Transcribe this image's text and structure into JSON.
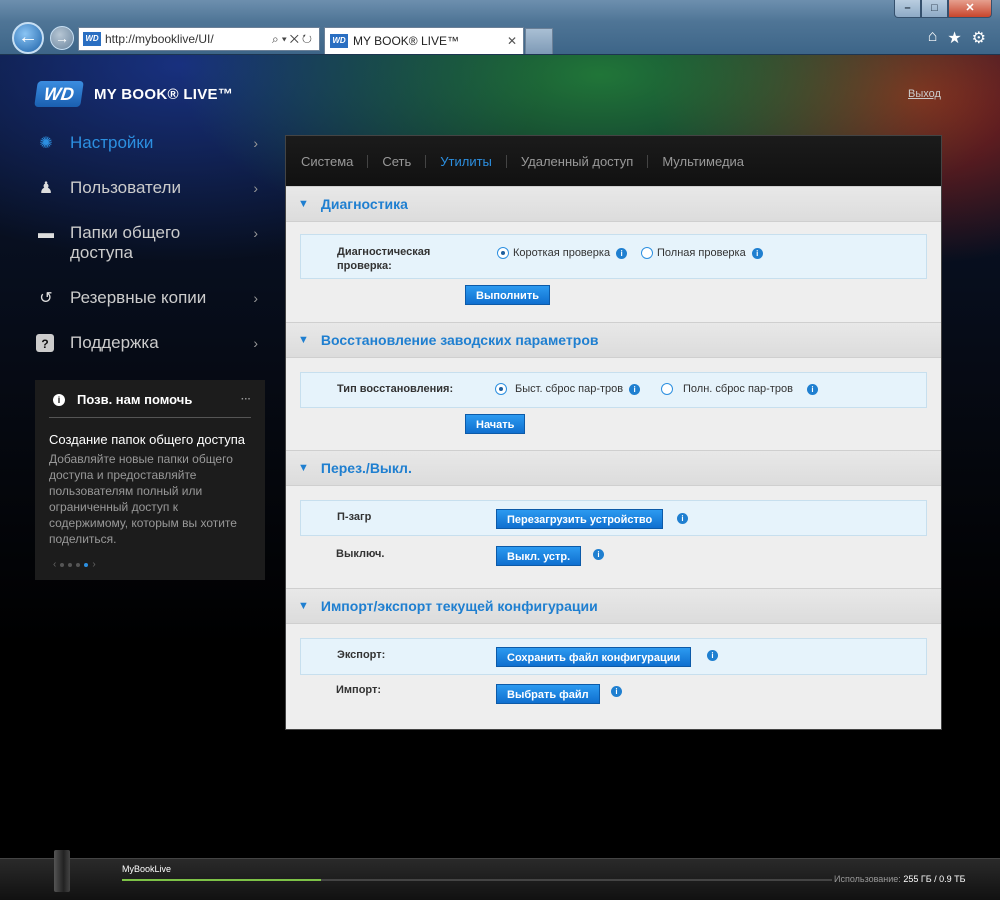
{
  "browser": {
    "url": "http://mybooklive/UI/",
    "tab_title": "MY BOOK® LIVE™",
    "favicon_text": "WD"
  },
  "header": {
    "logo_text": "WD",
    "product": "MY BOOK® LIVE™",
    "logout": "Выход"
  },
  "sidebar": {
    "items": [
      {
        "label": "Настройки",
        "icon": "gear-icon"
      },
      {
        "label": "Пользователи",
        "icon": "users-icon"
      },
      {
        "label": "Папки общего доступа",
        "icon": "folder-icon"
      },
      {
        "label": "Резервные копии",
        "icon": "history-icon"
      },
      {
        "label": "Поддержка",
        "icon": "question-icon"
      }
    ],
    "help": {
      "title": "Позв. нам помочь",
      "article_title": "Создание папок общего доступа",
      "article_body": "Добавляйте новые папки общего доступа и предоставляйте пользователям полный или ограниченный доступ к содержимому, которым вы хотите поделиться."
    }
  },
  "tabs": [
    "Система",
    "Сеть",
    "Утилиты",
    "Удаленный доступ",
    "Мультимедиа"
  ],
  "sections": {
    "diag": {
      "title": "Диагностика",
      "label": "Диагностическая проверка:",
      "opt_short": "Короткая проверка",
      "opt_full": "Полная проверка",
      "button": "Выполнить"
    },
    "restore": {
      "title": "Восстановление заводских параметров",
      "label": "Тип восстановления:",
      "opt_quick": "Быст. сброс пар-тров",
      "opt_full": "Полн. сброс пар-тров",
      "button": "Начать"
    },
    "power": {
      "title": "Перез./Выкл.",
      "reboot_label": "П-загр",
      "reboot_button": "Перезагрузить устройство",
      "off_label": "Выключ.",
      "off_button": "Выкл. устр."
    },
    "config": {
      "title": "Импорт/экспорт текущей конфигурации",
      "export_label": "Экспорт:",
      "export_button": "Сохранить файл конфигурации",
      "import_label": "Импорт:",
      "import_button": "Выбрать файл"
    }
  },
  "footer": {
    "device_name": "MyBookLive",
    "usage_label": "Использование:",
    "usage_value": "255 ГБ / 0.9 ТБ",
    "usage_fraction": 0.28
  }
}
